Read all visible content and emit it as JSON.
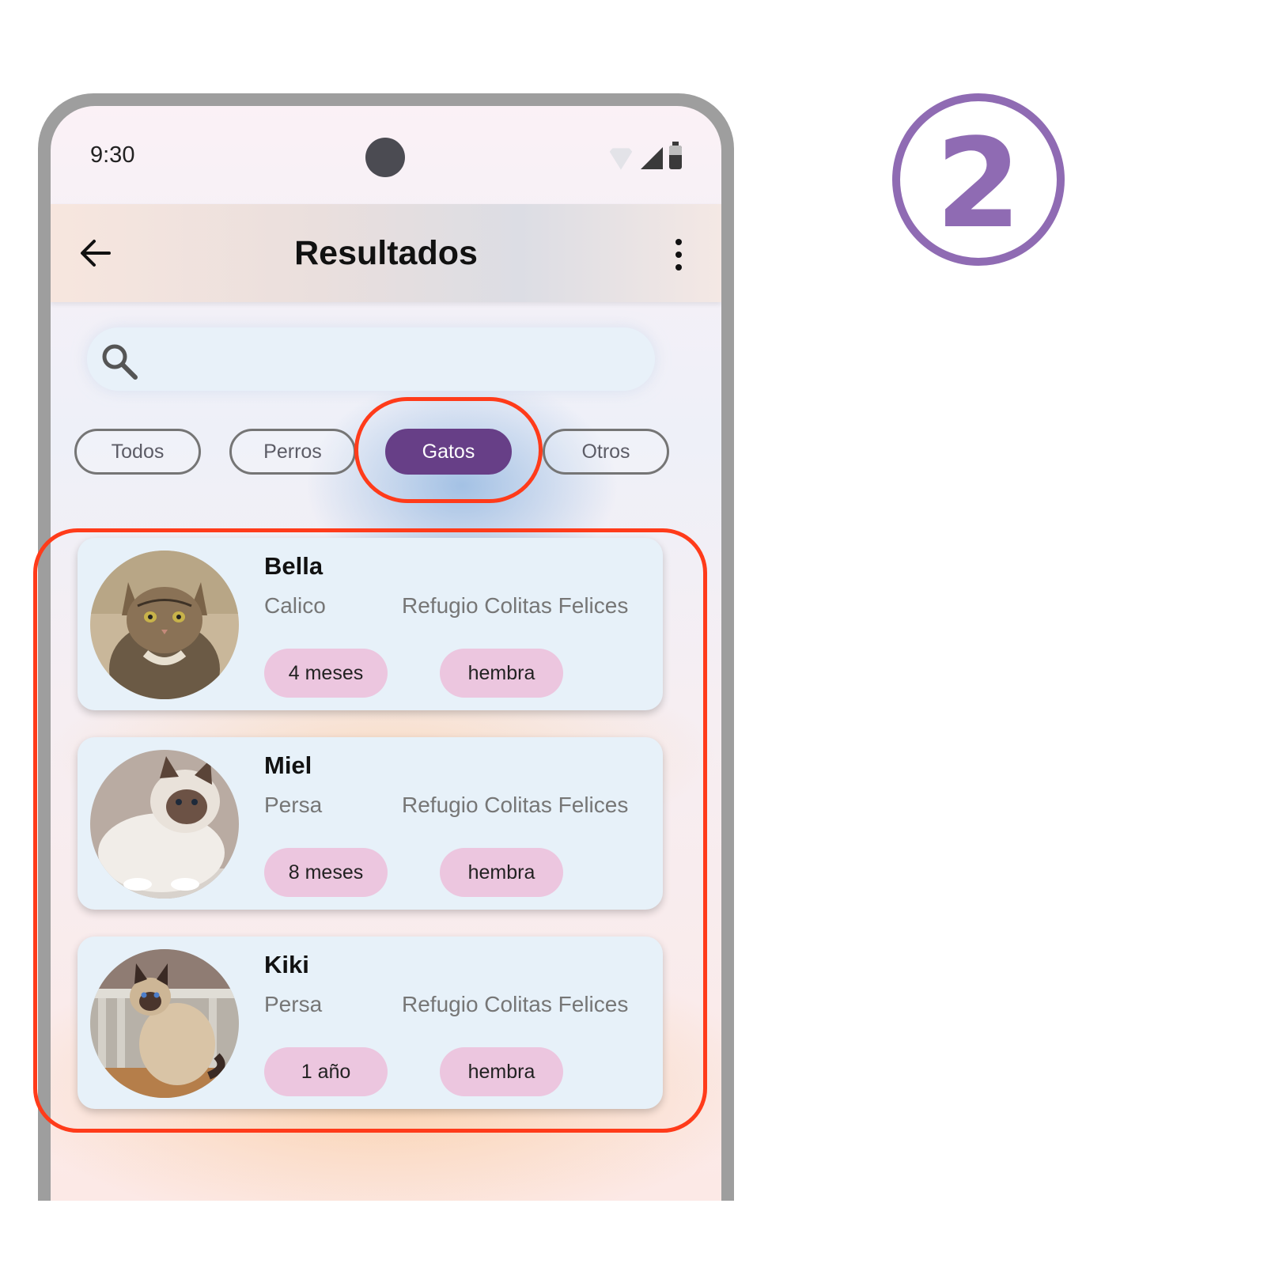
{
  "status_bar": {
    "time": "9:30"
  },
  "app_bar": {
    "title": "Resultados"
  },
  "search": {
    "placeholder": ""
  },
  "filters": [
    {
      "label": "Todos",
      "selected": false
    },
    {
      "label": "Perros",
      "selected": false
    },
    {
      "label": "Gatos",
      "selected": true
    },
    {
      "label": "Otros",
      "selected": false
    }
  ],
  "pets": [
    {
      "name": "Bella",
      "breed": "Calico",
      "shelter": "Refugio Colitas Felices",
      "age": "4 meses",
      "sex": "hembra"
    },
    {
      "name": "Miel",
      "breed": "Persa",
      "shelter": "Refugio Colitas Felices",
      "age": "8 meses",
      "sex": "hembra"
    },
    {
      "name": "Kiki",
      "breed": "Persa",
      "shelter": "Refugio Colitas Felices",
      "age": "1 año",
      "sex": "hembra"
    }
  ],
  "step_badge": {
    "number": "2",
    "color": "#8f6bb3"
  },
  "colors": {
    "accent": "#673f87",
    "tag": "#ecc6df",
    "card": "#e7f1f9",
    "highlight": "#ff3b1a"
  }
}
